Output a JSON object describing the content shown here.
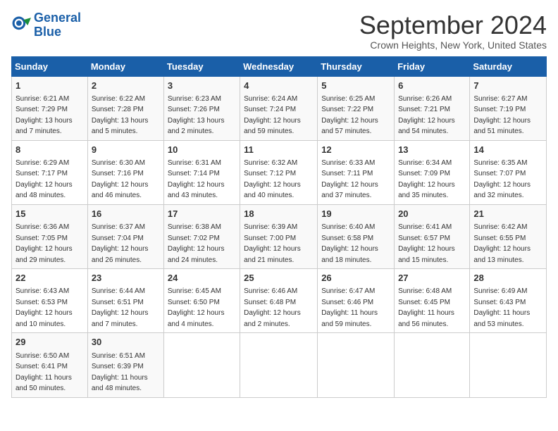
{
  "header": {
    "logo_line1": "General",
    "logo_line2": "Blue",
    "title": "September 2024",
    "subtitle": "Crown Heights, New York, United States"
  },
  "weekdays": [
    "Sunday",
    "Monday",
    "Tuesday",
    "Wednesday",
    "Thursday",
    "Friday",
    "Saturday"
  ],
  "weeks": [
    [
      {
        "day": "1",
        "sunrise": "Sunrise: 6:21 AM",
        "sunset": "Sunset: 7:29 PM",
        "daylight": "Daylight: 13 hours and 7 minutes."
      },
      {
        "day": "2",
        "sunrise": "Sunrise: 6:22 AM",
        "sunset": "Sunset: 7:28 PM",
        "daylight": "Daylight: 13 hours and 5 minutes."
      },
      {
        "day": "3",
        "sunrise": "Sunrise: 6:23 AM",
        "sunset": "Sunset: 7:26 PM",
        "daylight": "Daylight: 13 hours and 2 minutes."
      },
      {
        "day": "4",
        "sunrise": "Sunrise: 6:24 AM",
        "sunset": "Sunset: 7:24 PM",
        "daylight": "Daylight: 12 hours and 59 minutes."
      },
      {
        "day": "5",
        "sunrise": "Sunrise: 6:25 AM",
        "sunset": "Sunset: 7:22 PM",
        "daylight": "Daylight: 12 hours and 57 minutes."
      },
      {
        "day": "6",
        "sunrise": "Sunrise: 6:26 AM",
        "sunset": "Sunset: 7:21 PM",
        "daylight": "Daylight: 12 hours and 54 minutes."
      },
      {
        "day": "7",
        "sunrise": "Sunrise: 6:27 AM",
        "sunset": "Sunset: 7:19 PM",
        "daylight": "Daylight: 12 hours and 51 minutes."
      }
    ],
    [
      {
        "day": "8",
        "sunrise": "Sunrise: 6:29 AM",
        "sunset": "Sunset: 7:17 PM",
        "daylight": "Daylight: 12 hours and 48 minutes."
      },
      {
        "day": "9",
        "sunrise": "Sunrise: 6:30 AM",
        "sunset": "Sunset: 7:16 PM",
        "daylight": "Daylight: 12 hours and 46 minutes."
      },
      {
        "day": "10",
        "sunrise": "Sunrise: 6:31 AM",
        "sunset": "Sunset: 7:14 PM",
        "daylight": "Daylight: 12 hours and 43 minutes."
      },
      {
        "day": "11",
        "sunrise": "Sunrise: 6:32 AM",
        "sunset": "Sunset: 7:12 PM",
        "daylight": "Daylight: 12 hours and 40 minutes."
      },
      {
        "day": "12",
        "sunrise": "Sunrise: 6:33 AM",
        "sunset": "Sunset: 7:11 PM",
        "daylight": "Daylight: 12 hours and 37 minutes."
      },
      {
        "day": "13",
        "sunrise": "Sunrise: 6:34 AM",
        "sunset": "Sunset: 7:09 PM",
        "daylight": "Daylight: 12 hours and 35 minutes."
      },
      {
        "day": "14",
        "sunrise": "Sunrise: 6:35 AM",
        "sunset": "Sunset: 7:07 PM",
        "daylight": "Daylight: 12 hours and 32 minutes."
      }
    ],
    [
      {
        "day": "15",
        "sunrise": "Sunrise: 6:36 AM",
        "sunset": "Sunset: 7:05 PM",
        "daylight": "Daylight: 12 hours and 29 minutes."
      },
      {
        "day": "16",
        "sunrise": "Sunrise: 6:37 AM",
        "sunset": "Sunset: 7:04 PM",
        "daylight": "Daylight: 12 hours and 26 minutes."
      },
      {
        "day": "17",
        "sunrise": "Sunrise: 6:38 AM",
        "sunset": "Sunset: 7:02 PM",
        "daylight": "Daylight: 12 hours and 24 minutes."
      },
      {
        "day": "18",
        "sunrise": "Sunrise: 6:39 AM",
        "sunset": "Sunset: 7:00 PM",
        "daylight": "Daylight: 12 hours and 21 minutes."
      },
      {
        "day": "19",
        "sunrise": "Sunrise: 6:40 AM",
        "sunset": "Sunset: 6:58 PM",
        "daylight": "Daylight: 12 hours and 18 minutes."
      },
      {
        "day": "20",
        "sunrise": "Sunrise: 6:41 AM",
        "sunset": "Sunset: 6:57 PM",
        "daylight": "Daylight: 12 hours and 15 minutes."
      },
      {
        "day": "21",
        "sunrise": "Sunrise: 6:42 AM",
        "sunset": "Sunset: 6:55 PM",
        "daylight": "Daylight: 12 hours and 13 minutes."
      }
    ],
    [
      {
        "day": "22",
        "sunrise": "Sunrise: 6:43 AM",
        "sunset": "Sunset: 6:53 PM",
        "daylight": "Daylight: 12 hours and 10 minutes."
      },
      {
        "day": "23",
        "sunrise": "Sunrise: 6:44 AM",
        "sunset": "Sunset: 6:51 PM",
        "daylight": "Daylight: 12 hours and 7 minutes."
      },
      {
        "day": "24",
        "sunrise": "Sunrise: 6:45 AM",
        "sunset": "Sunset: 6:50 PM",
        "daylight": "Daylight: 12 hours and 4 minutes."
      },
      {
        "day": "25",
        "sunrise": "Sunrise: 6:46 AM",
        "sunset": "Sunset: 6:48 PM",
        "daylight": "Daylight: 12 hours and 2 minutes."
      },
      {
        "day": "26",
        "sunrise": "Sunrise: 6:47 AM",
        "sunset": "Sunset: 6:46 PM",
        "daylight": "Daylight: 11 hours and 59 minutes."
      },
      {
        "day": "27",
        "sunrise": "Sunrise: 6:48 AM",
        "sunset": "Sunset: 6:45 PM",
        "daylight": "Daylight: 11 hours and 56 minutes."
      },
      {
        "day": "28",
        "sunrise": "Sunrise: 6:49 AM",
        "sunset": "Sunset: 6:43 PM",
        "daylight": "Daylight: 11 hours and 53 minutes."
      }
    ],
    [
      {
        "day": "29",
        "sunrise": "Sunrise: 6:50 AM",
        "sunset": "Sunset: 6:41 PM",
        "daylight": "Daylight: 11 hours and 50 minutes."
      },
      {
        "day": "30",
        "sunrise": "Sunrise: 6:51 AM",
        "sunset": "Sunset: 6:39 PM",
        "daylight": "Daylight: 11 hours and 48 minutes."
      },
      null,
      null,
      null,
      null,
      null
    ]
  ]
}
